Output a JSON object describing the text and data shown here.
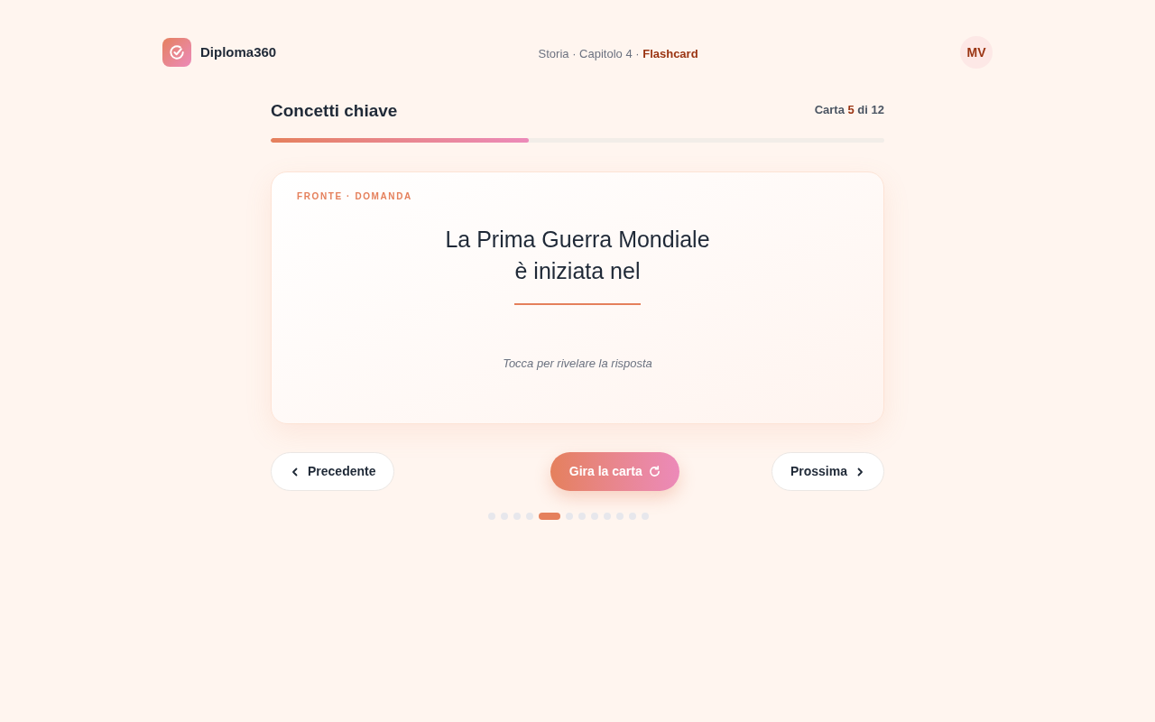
{
  "header": {
    "brand": "Diploma360",
    "breadcrumb": "Storia · Capitolo 4 · **Flashcard**",
    "avatar": "MV"
  },
  "deck": {
    "title": "Concetti chiave",
    "counter": "Carta **5** di 12",
    "progress": {
      "level": 0.42
    }
  },
  "card": {
    "side_label": "FRONTE · DOMANDA",
    "question": "La Prima Guerra Mondiale\nè iniziata nel",
    "hint": "Tocca per rivelare la risposta"
  },
  "buttons": [
    {
      "kind": "prev",
      "label": "Precedente"
    },
    {
      "kind": "flip",
      "label": "Gira la carta"
    },
    {
      "kind": "next",
      "label": "Prossima"
    }
  ],
  "pager": [
    {
      "selected": false
    },
    {
      "selected": false
    },
    {
      "selected": false
    },
    {
      "selected": false
    },
    {
      "selected": true
    },
    {
      "selected": false
    },
    {
      "selected": false
    },
    {
      "selected": false
    },
    {
      "selected": false
    },
    {
      "selected": false
    },
    {
      "selected": false
    },
    {
      "selected": false
    }
  ]
}
